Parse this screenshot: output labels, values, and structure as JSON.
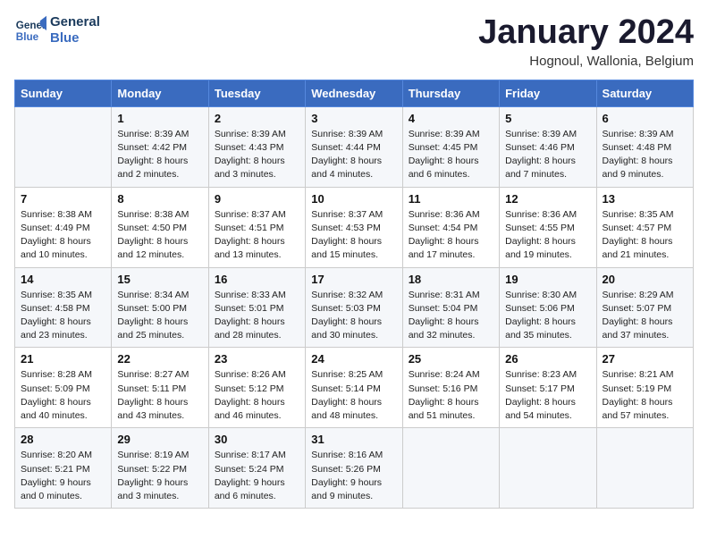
{
  "header": {
    "logo_line1": "General",
    "logo_line2": "Blue",
    "month": "January 2024",
    "location": "Hognoul, Wallonia, Belgium"
  },
  "days_of_week": [
    "Sunday",
    "Monday",
    "Tuesday",
    "Wednesday",
    "Thursday",
    "Friday",
    "Saturday"
  ],
  "weeks": [
    [
      {
        "num": "",
        "sunrise": "",
        "sunset": "",
        "daylight": ""
      },
      {
        "num": "1",
        "sunrise": "Sunrise: 8:39 AM",
        "sunset": "Sunset: 4:42 PM",
        "daylight": "Daylight: 8 hours and 2 minutes."
      },
      {
        "num": "2",
        "sunrise": "Sunrise: 8:39 AM",
        "sunset": "Sunset: 4:43 PM",
        "daylight": "Daylight: 8 hours and 3 minutes."
      },
      {
        "num": "3",
        "sunrise": "Sunrise: 8:39 AM",
        "sunset": "Sunset: 4:44 PM",
        "daylight": "Daylight: 8 hours and 4 minutes."
      },
      {
        "num": "4",
        "sunrise": "Sunrise: 8:39 AM",
        "sunset": "Sunset: 4:45 PM",
        "daylight": "Daylight: 8 hours and 6 minutes."
      },
      {
        "num": "5",
        "sunrise": "Sunrise: 8:39 AM",
        "sunset": "Sunset: 4:46 PM",
        "daylight": "Daylight: 8 hours and 7 minutes."
      },
      {
        "num": "6",
        "sunrise": "Sunrise: 8:39 AM",
        "sunset": "Sunset: 4:48 PM",
        "daylight": "Daylight: 8 hours and 9 minutes."
      }
    ],
    [
      {
        "num": "7",
        "sunrise": "Sunrise: 8:38 AM",
        "sunset": "Sunset: 4:49 PM",
        "daylight": "Daylight: 8 hours and 10 minutes."
      },
      {
        "num": "8",
        "sunrise": "Sunrise: 8:38 AM",
        "sunset": "Sunset: 4:50 PM",
        "daylight": "Daylight: 8 hours and 12 minutes."
      },
      {
        "num": "9",
        "sunrise": "Sunrise: 8:37 AM",
        "sunset": "Sunset: 4:51 PM",
        "daylight": "Daylight: 8 hours and 13 minutes."
      },
      {
        "num": "10",
        "sunrise": "Sunrise: 8:37 AM",
        "sunset": "Sunset: 4:53 PM",
        "daylight": "Daylight: 8 hours and 15 minutes."
      },
      {
        "num": "11",
        "sunrise": "Sunrise: 8:36 AM",
        "sunset": "Sunset: 4:54 PM",
        "daylight": "Daylight: 8 hours and 17 minutes."
      },
      {
        "num": "12",
        "sunrise": "Sunrise: 8:36 AM",
        "sunset": "Sunset: 4:55 PM",
        "daylight": "Daylight: 8 hours and 19 minutes."
      },
      {
        "num": "13",
        "sunrise": "Sunrise: 8:35 AM",
        "sunset": "Sunset: 4:57 PM",
        "daylight": "Daylight: 8 hours and 21 minutes."
      }
    ],
    [
      {
        "num": "14",
        "sunrise": "Sunrise: 8:35 AM",
        "sunset": "Sunset: 4:58 PM",
        "daylight": "Daylight: 8 hours and 23 minutes."
      },
      {
        "num": "15",
        "sunrise": "Sunrise: 8:34 AM",
        "sunset": "Sunset: 5:00 PM",
        "daylight": "Daylight: 8 hours and 25 minutes."
      },
      {
        "num": "16",
        "sunrise": "Sunrise: 8:33 AM",
        "sunset": "Sunset: 5:01 PM",
        "daylight": "Daylight: 8 hours and 28 minutes."
      },
      {
        "num": "17",
        "sunrise": "Sunrise: 8:32 AM",
        "sunset": "Sunset: 5:03 PM",
        "daylight": "Daylight: 8 hours and 30 minutes."
      },
      {
        "num": "18",
        "sunrise": "Sunrise: 8:31 AM",
        "sunset": "Sunset: 5:04 PM",
        "daylight": "Daylight: 8 hours and 32 minutes."
      },
      {
        "num": "19",
        "sunrise": "Sunrise: 8:30 AM",
        "sunset": "Sunset: 5:06 PM",
        "daylight": "Daylight: 8 hours and 35 minutes."
      },
      {
        "num": "20",
        "sunrise": "Sunrise: 8:29 AM",
        "sunset": "Sunset: 5:07 PM",
        "daylight": "Daylight: 8 hours and 37 minutes."
      }
    ],
    [
      {
        "num": "21",
        "sunrise": "Sunrise: 8:28 AM",
        "sunset": "Sunset: 5:09 PM",
        "daylight": "Daylight: 8 hours and 40 minutes."
      },
      {
        "num": "22",
        "sunrise": "Sunrise: 8:27 AM",
        "sunset": "Sunset: 5:11 PM",
        "daylight": "Daylight: 8 hours and 43 minutes."
      },
      {
        "num": "23",
        "sunrise": "Sunrise: 8:26 AM",
        "sunset": "Sunset: 5:12 PM",
        "daylight": "Daylight: 8 hours and 46 minutes."
      },
      {
        "num": "24",
        "sunrise": "Sunrise: 8:25 AM",
        "sunset": "Sunset: 5:14 PM",
        "daylight": "Daylight: 8 hours and 48 minutes."
      },
      {
        "num": "25",
        "sunrise": "Sunrise: 8:24 AM",
        "sunset": "Sunset: 5:16 PM",
        "daylight": "Daylight: 8 hours and 51 minutes."
      },
      {
        "num": "26",
        "sunrise": "Sunrise: 8:23 AM",
        "sunset": "Sunset: 5:17 PM",
        "daylight": "Daylight: 8 hours and 54 minutes."
      },
      {
        "num": "27",
        "sunrise": "Sunrise: 8:21 AM",
        "sunset": "Sunset: 5:19 PM",
        "daylight": "Daylight: 8 hours and 57 minutes."
      }
    ],
    [
      {
        "num": "28",
        "sunrise": "Sunrise: 8:20 AM",
        "sunset": "Sunset: 5:21 PM",
        "daylight": "Daylight: 9 hours and 0 minutes."
      },
      {
        "num": "29",
        "sunrise": "Sunrise: 8:19 AM",
        "sunset": "Sunset: 5:22 PM",
        "daylight": "Daylight: 9 hours and 3 minutes."
      },
      {
        "num": "30",
        "sunrise": "Sunrise: 8:17 AM",
        "sunset": "Sunset: 5:24 PM",
        "daylight": "Daylight: 9 hours and 6 minutes."
      },
      {
        "num": "31",
        "sunrise": "Sunrise: 8:16 AM",
        "sunset": "Sunset: 5:26 PM",
        "daylight": "Daylight: 9 hours and 9 minutes."
      },
      {
        "num": "",
        "sunrise": "",
        "sunset": "",
        "daylight": ""
      },
      {
        "num": "",
        "sunrise": "",
        "sunset": "",
        "daylight": ""
      },
      {
        "num": "",
        "sunrise": "",
        "sunset": "",
        "daylight": ""
      }
    ]
  ]
}
